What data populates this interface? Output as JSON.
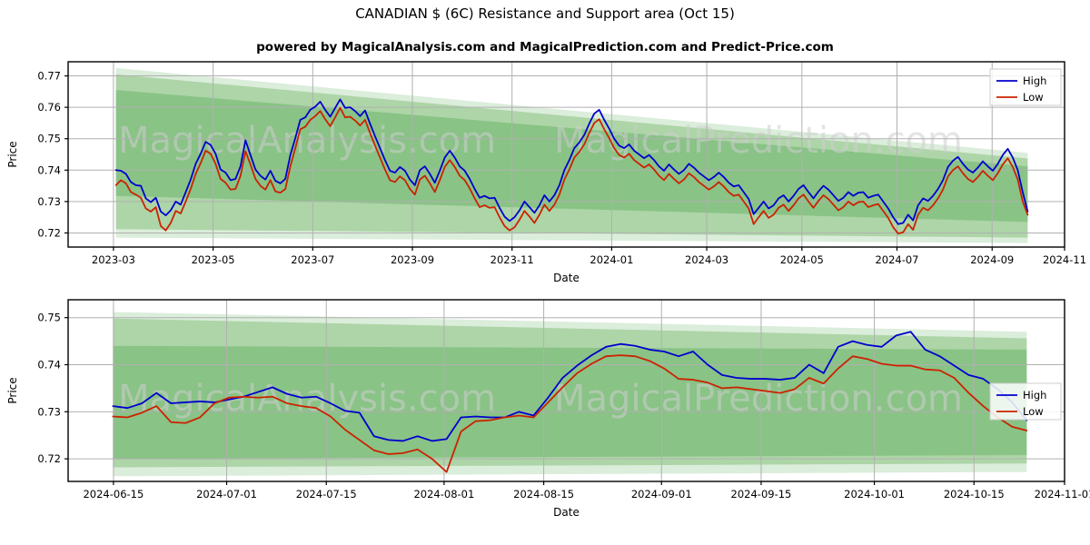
{
  "header": {
    "title": "CANADIAN $ (6C) Resistance and Support area (Oct 15)",
    "subtitle": "powered by MagicalAnalysis.com and MagicalPrediction.com and Predict-Price.com"
  },
  "watermarks": [
    "MagicalAnalysis.com",
    "MagicalPrediction.com"
  ],
  "colors": {
    "high_line": "#0000cd",
    "low_line": "#cc2200",
    "band_outer": "#d8ecd8",
    "band_mid": "#a9d3a3",
    "band_inner": "#86c183",
    "grid": "#b0b0b0",
    "axis": "#000000",
    "watermark": "#cfcfcf"
  },
  "chart_data": [
    {
      "id": "long-term-chart",
      "type": "line",
      "title": "CANADIAN $ (6C) Resistance and Support area (Oct 15)",
      "xlabel": "Date",
      "ylabel": "Price",
      "ylim": [
        0.7155,
        0.7745
      ],
      "yticks": [
        0.72,
        0.73,
        0.74,
        0.75,
        0.76,
        0.77
      ],
      "ytick_labels": [
        "0.72",
        "0.73",
        "0.74",
        "0.75",
        "0.76",
        "0.77"
      ],
      "xtick_labels": [
        "2023-03",
        "2023-05",
        "2023-07",
        "2023-09",
        "2023-11",
        "2024-01",
        "2024-03",
        "2024-05",
        "2024-07",
        "2024-09",
        "2024-11"
      ],
      "xtick_positions": [
        0.0455,
        0.1455,
        0.2455,
        0.3455,
        0.4455,
        0.5455,
        0.6409,
        0.7364,
        0.8318,
        0.9273,
        1.0
      ],
      "grid": true,
      "legend": {
        "position": "upper right",
        "entries": [
          {
            "label": "High",
            "color": "#0000cd"
          },
          {
            "label": "Low",
            "color": "#cc2200"
          }
        ]
      },
      "bands": [
        {
          "name": "outer-resistance-support",
          "color": "#d8ecd8",
          "x_start": 0.048,
          "x_end": 0.963,
          "y_top_start": 0.7725,
          "y_top_end": 0.7455,
          "y_bot_start": 0.7185,
          "y_bot_end": 0.7168
        },
        {
          "name": "mid-resistance-support",
          "color": "#a9d3a3",
          "x_start": 0.048,
          "x_end": 0.963,
          "y_top_start": 0.7705,
          "y_top_end": 0.7437,
          "y_bot_start": 0.7212,
          "y_bot_end": 0.7185
        },
        {
          "name": "inner-resistance-support",
          "color": "#86c183",
          "x_start": 0.048,
          "x_end": 0.963,
          "y_top_start": 0.7655,
          "y_top_end": 0.7412,
          "y_bot_start": 0.7318,
          "y_bot_end": 0.7235
        }
      ],
      "series": [
        {
          "name": "High",
          "color": "#0000cd",
          "values": [
            0.74,
            0.7398,
            0.7388,
            0.7362,
            0.7352,
            0.735,
            0.731,
            0.7298,
            0.7312,
            0.7268,
            0.7256,
            0.7272,
            0.73,
            0.729,
            0.733,
            0.737,
            0.742,
            0.7452,
            0.749,
            0.748,
            0.7452,
            0.7402,
            0.7392,
            0.7368,
            0.7372,
            0.7412,
            0.7495,
            0.7448,
            0.7402,
            0.7382,
            0.737,
            0.7398,
            0.7366,
            0.7358,
            0.7372,
            0.7448,
            0.7502,
            0.756,
            0.7568,
            0.7592,
            0.7602,
            0.7618,
            0.7592,
            0.757,
            0.7598,
            0.7625,
            0.7598,
            0.76,
            0.7588,
            0.7572,
            0.759,
            0.7548,
            0.7508,
            0.747,
            0.7432,
            0.7398,
            0.7392,
            0.741,
            0.7398,
            0.737,
            0.7352,
            0.74,
            0.7412,
            0.7388,
            0.736,
            0.7398,
            0.744,
            0.7462,
            0.744,
            0.7412,
            0.7398,
            0.7372,
            0.734,
            0.7312,
            0.7318,
            0.731,
            0.7312,
            0.728,
            0.7252,
            0.7238,
            0.725,
            0.7272,
            0.73,
            0.7282,
            0.7264,
            0.7288,
            0.732,
            0.73,
            0.732,
            0.7352,
            0.74,
            0.7432,
            0.747,
            0.7488,
            0.7512,
            0.7548,
            0.758,
            0.7592,
            0.756,
            0.7532,
            0.75,
            0.7478,
            0.747,
            0.7482,
            0.7462,
            0.745,
            0.7438,
            0.7448,
            0.7432,
            0.7412,
            0.7398,
            0.7418,
            0.7402,
            0.7388,
            0.74,
            0.742,
            0.7408,
            0.7392,
            0.738,
            0.7368,
            0.7378,
            0.7392,
            0.7378,
            0.736,
            0.7348,
            0.7352,
            0.733,
            0.7308,
            0.726,
            0.728,
            0.73,
            0.7278,
            0.7288,
            0.731,
            0.732,
            0.73,
            0.7318,
            0.734,
            0.7352,
            0.733,
            0.731,
            0.7332,
            0.735,
            0.7338,
            0.732,
            0.7302,
            0.7312,
            0.733,
            0.7318,
            0.7328,
            0.733,
            0.7312,
            0.7318,
            0.7322,
            0.73,
            0.7278,
            0.725,
            0.7228,
            0.7232,
            0.7258,
            0.724,
            0.7288,
            0.731,
            0.7302,
            0.7318,
            0.734,
            0.7368,
            0.741,
            0.743,
            0.7442,
            0.742,
            0.7402,
            0.7392,
            0.7408,
            0.7428,
            0.7412,
            0.7398,
            0.742,
            0.7448,
            0.7468,
            0.744,
            0.74,
            0.733,
            0.7268
          ]
        },
        {
          "name": "Low",
          "color": "#cc2200",
          "values": [
            0.7352,
            0.7368,
            0.7358,
            0.733,
            0.7322,
            0.7312,
            0.7278,
            0.7268,
            0.7282,
            0.7222,
            0.7208,
            0.7232,
            0.727,
            0.7262,
            0.73,
            0.734,
            0.7388,
            0.7422,
            0.7462,
            0.7452,
            0.742,
            0.7372,
            0.736,
            0.7338,
            0.734,
            0.7382,
            0.746,
            0.7418,
            0.7372,
            0.735,
            0.7338,
            0.7368,
            0.7332,
            0.7328,
            0.734,
            0.7412,
            0.747,
            0.753,
            0.7538,
            0.756,
            0.7572,
            0.7588,
            0.7562,
            0.754,
            0.7568,
            0.7598,
            0.7568,
            0.757,
            0.7558,
            0.7542,
            0.756,
            0.7518,
            0.7478,
            0.744,
            0.7402,
            0.7368,
            0.7362,
            0.738,
            0.7368,
            0.734,
            0.7322,
            0.737,
            0.7382,
            0.7358,
            0.733,
            0.7368,
            0.741,
            0.7432,
            0.741,
            0.7382,
            0.7368,
            0.7342,
            0.731,
            0.7282,
            0.7288,
            0.728,
            0.7282,
            0.725,
            0.7222,
            0.7208,
            0.7218,
            0.7242,
            0.727,
            0.7252,
            0.7232,
            0.7258,
            0.729,
            0.727,
            0.729,
            0.7322,
            0.737,
            0.7402,
            0.744,
            0.7458,
            0.7482,
            0.7518,
            0.755,
            0.7562,
            0.753,
            0.7502,
            0.747,
            0.7448,
            0.744,
            0.7452,
            0.7432,
            0.742,
            0.7408,
            0.7418,
            0.7402,
            0.7382,
            0.7368,
            0.7388,
            0.7372,
            0.7358,
            0.737,
            0.739,
            0.7378,
            0.7362,
            0.735,
            0.7338,
            0.7348,
            0.7362,
            0.7348,
            0.733,
            0.7318,
            0.7322,
            0.73,
            0.7278,
            0.7228,
            0.725,
            0.727,
            0.7248,
            0.7258,
            0.728,
            0.729,
            0.727,
            0.7288,
            0.731,
            0.7322,
            0.73,
            0.728,
            0.7302,
            0.732,
            0.7308,
            0.729,
            0.7272,
            0.7282,
            0.73,
            0.7288,
            0.7298,
            0.73,
            0.7282,
            0.7288,
            0.7292,
            0.727,
            0.7248,
            0.7218,
            0.7198,
            0.7202,
            0.7228,
            0.721,
            0.7258,
            0.728,
            0.7272,
            0.7288,
            0.731,
            0.7338,
            0.738,
            0.74,
            0.7412,
            0.739,
            0.7372,
            0.7362,
            0.7378,
            0.7398,
            0.7382,
            0.7368,
            0.739,
            0.7418,
            0.7438,
            0.741,
            0.737,
            0.73,
            0.7258
          ]
        }
      ]
    },
    {
      "id": "short-term-chart",
      "type": "line",
      "xlabel": "Date",
      "ylabel": "Price",
      "ylim": [
        0.7152,
        0.7538
      ],
      "yticks": [
        0.72,
        0.73,
        0.74,
        0.75
      ],
      "ytick_labels": [
        "0.72",
        "0.73",
        "0.74",
        "0.75"
      ],
      "xtick_labels": [
        "2024-06-15",
        "2024-07-01",
        "2024-07-15",
        "2024-08-01",
        "2024-08-15",
        "2024-09-01",
        "2024-09-15",
        "2024-10-01",
        "2024-10-15",
        "2024-11-01"
      ],
      "xtick_positions": [
        0.0455,
        0.1591,
        0.2591,
        0.3773,
        0.4773,
        0.5955,
        0.6955,
        0.8091,
        0.9091,
        1.0
      ],
      "grid": true,
      "legend": {
        "position": "center right",
        "entries": [
          {
            "label": "High",
            "color": "#0000cd"
          },
          {
            "label": "Low",
            "color": "#cc2200"
          }
        ]
      },
      "bands": [
        {
          "name": "outer-resistance-support",
          "color": "#d8ecd8",
          "x_start": 0.045,
          "x_end": 0.962,
          "y_top_start": 0.7512,
          "y_top_end": 0.747,
          "y_bot_start": 0.7163,
          "y_bot_end": 0.7172
        },
        {
          "name": "mid-resistance-support",
          "color": "#a9d3a3",
          "x_start": 0.045,
          "x_end": 0.962,
          "y_top_start": 0.7498,
          "y_top_end": 0.7456,
          "y_bot_start": 0.7182,
          "y_bot_end": 0.719
        },
        {
          "name": "inner-resistance-support",
          "color": "#86c183",
          "x_start": 0.045,
          "x_end": 0.962,
          "y_top_start": 0.744,
          "y_top_end": 0.7432,
          "y_bot_start": 0.72,
          "y_bot_end": 0.7208
        }
      ],
      "series": [
        {
          "name": "High",
          "color": "#0000cd",
          "values": [
            0.7312,
            0.7308,
            0.7318,
            0.734,
            0.7318,
            0.732,
            0.7322,
            0.732,
            0.7326,
            0.7332,
            0.7342,
            0.7352,
            0.7338,
            0.733,
            0.7332,
            0.7318,
            0.7302,
            0.7298,
            0.7248,
            0.724,
            0.7238,
            0.7248,
            0.7238,
            0.7242,
            0.7288,
            0.729,
            0.7288,
            0.7288,
            0.73,
            0.7292,
            0.733,
            0.7372,
            0.7398,
            0.742,
            0.7438,
            0.7444,
            0.744,
            0.7432,
            0.7428,
            0.7418,
            0.7428,
            0.74,
            0.7378,
            0.7372,
            0.737,
            0.737,
            0.7368,
            0.7372,
            0.74,
            0.7382,
            0.7438,
            0.745,
            0.7442,
            0.7438,
            0.7462,
            0.747,
            0.7432,
            0.7418,
            0.7398,
            0.7378,
            0.737,
            0.7348,
            0.732,
            0.7282
          ]
        },
        {
          "name": "Low",
          "color": "#cc2200",
          "values": [
            0.729,
            0.7288,
            0.7298,
            0.7312,
            0.7278,
            0.7276,
            0.7288,
            0.7318,
            0.733,
            0.7332,
            0.733,
            0.7332,
            0.7318,
            0.7312,
            0.7308,
            0.729,
            0.7262,
            0.724,
            0.7218,
            0.721,
            0.7212,
            0.722,
            0.72,
            0.7172,
            0.7258,
            0.728,
            0.7282,
            0.7288,
            0.7292,
            0.7288,
            0.732,
            0.7352,
            0.7382,
            0.7402,
            0.7418,
            0.742,
            0.7418,
            0.7408,
            0.7392,
            0.737,
            0.7368,
            0.7362,
            0.735,
            0.7352,
            0.7348,
            0.7344,
            0.734,
            0.7348,
            0.7372,
            0.736,
            0.7392,
            0.7418,
            0.7412,
            0.7402,
            0.7398,
            0.7398,
            0.739,
            0.7388,
            0.7372,
            0.734,
            0.7312,
            0.7288,
            0.7268,
            0.726
          ]
        }
      ]
    }
  ]
}
